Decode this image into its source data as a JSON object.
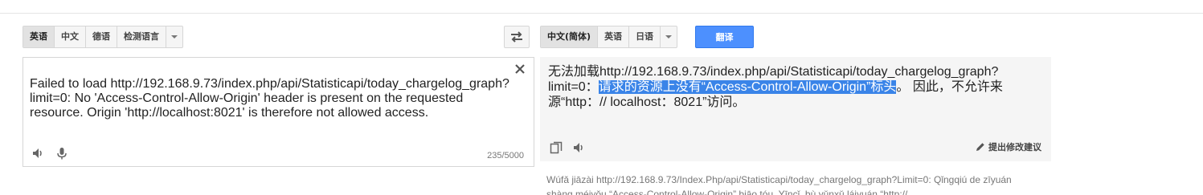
{
  "source_languages": {
    "items": [
      "英语",
      "中文",
      "德语",
      "检测语言"
    ],
    "selected": "英语"
  },
  "target_languages": {
    "items": [
      "中文(简体)",
      "英语",
      "日语"
    ],
    "selected": "中文(简体)"
  },
  "translate_button": "翻译",
  "source": {
    "text": "Failed to load http://192.168.9.73/index.php/api/Statisticapi/today_chargelog_graph?\nlimit=0: No 'Access-Control-Allow-Origin' header is present on the requested\nresource. Origin 'http://localhost:8021' is therefore not allowed access.",
    "char_count": "235/5000"
  },
  "result": {
    "before_highlight": "无法加载http://192.168.9.73/index.php/api/Statisticapi/today_chargelog_graph?limit=0：",
    "highlight": "请求的资源上没有“Access-Control-Allow-Origin”标头",
    "after_highlight": "。 因此，不允许来源“http：// localhost：8021”访问。",
    "suggest_label": "提出修改建议"
  },
  "romanization": "Wúfǎ jiāzài http://192.168.9.73/Index.Php/api/Statisticapi/today_chargelog_graph?Limit=0: Qǐngqiú de zīyuán shàng méiyǒu “Access-Control-Allow-Origin” biāo tóu. Yīncǐ, bù yǔnxǔ láiyuán “http://",
  "colors": {
    "accent": "#4d90fe",
    "highlight": "#3a84e8",
    "result_bg": "#f5f5f5"
  },
  "icons": {
    "swap": "swap-icon",
    "clear": "close-icon",
    "listen": "speaker-icon",
    "mic": "microphone-icon",
    "copy": "copy-icon",
    "pencil": "pencil-icon",
    "dropdown": "chevron-down-icon"
  }
}
